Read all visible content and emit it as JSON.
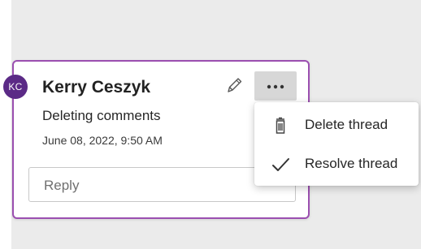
{
  "comment": {
    "avatar_initials": "KC",
    "author": "Kerry Ceszyk",
    "text": "Deleting comments",
    "timestamp": "June 08, 2022, 9:50 AM",
    "edit_icon": "pencil-icon",
    "more_icon": "ellipsis-icon"
  },
  "reply": {
    "placeholder": "Reply"
  },
  "menu": {
    "items": [
      {
        "label": "Delete thread",
        "icon": "trash-icon"
      },
      {
        "label": "Resolve thread",
        "icon": "checkmark-icon"
      }
    ]
  },
  "colors": {
    "card_border": "#9b4fb0",
    "avatar_bg": "#5b2a86",
    "more_button_bg": "#d7d7d7",
    "background": "#ebebeb"
  }
}
